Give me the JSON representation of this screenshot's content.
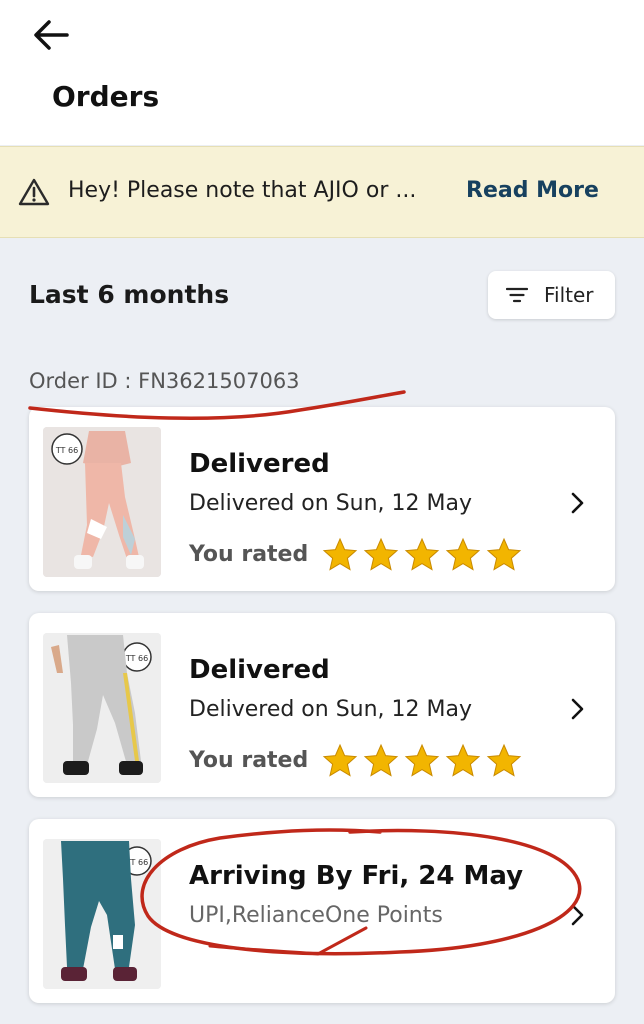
{
  "header": {
    "title": "Orders"
  },
  "banner": {
    "message": "Hey! Please note that AJIO or ...",
    "action": "Read More"
  },
  "section": {
    "title": "Last 6 months",
    "filter_label": "Filter"
  },
  "order": {
    "id_text": "Order ID : FN3621507063",
    "items": [
      {
        "status": "Delivered",
        "detail": "Delivered on Sun, 12 May",
        "rated_label": "You rated",
        "rating": 5
      },
      {
        "status": "Delivered",
        "detail": "Delivered on Sun, 12 May",
        "rated_label": "You rated",
        "rating": 5
      },
      {
        "status": "Arriving By Fri, 24 May",
        "detail": "UPI,RelianceOne Points"
      }
    ]
  },
  "colors": {
    "banner_bg": "#f7f2d6",
    "link": "#17415f",
    "star": "#f2b500",
    "annotation": "#c0281a"
  }
}
